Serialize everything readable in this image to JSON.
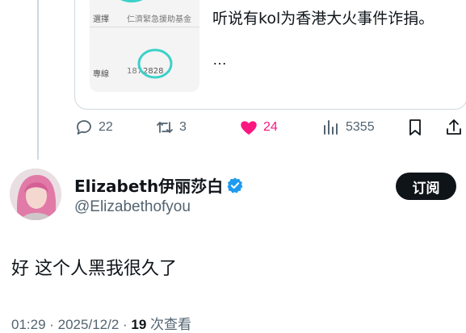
{
  "quoted": {
    "image_rows": [
      {
        "label": "選擇",
        "value": "仁濟緊急援助基金"
      },
      {
        "label": "專線",
        "value_prefix": "187",
        "value_suffix": "2828"
      }
    ],
    "text": "听说有kol为香港大火事件诈捐。",
    "ellipsis": "…"
  },
  "actions": {
    "replies": "22",
    "reposts": "3",
    "likes": "24",
    "views": "5355"
  },
  "colors": {
    "like": "#f91880",
    "muted": "#536471",
    "verified": "#1d9bf0"
  },
  "author": {
    "display_name": "Elizabeth伊丽莎白",
    "handle": "@Elizabethofyou",
    "subscribe_label": "订阅"
  },
  "tweet": {
    "text": "好 这个人黑我很久了"
  },
  "meta": {
    "time_date": "01:29 · 2025/12/2 · ",
    "views_count": "19",
    "views_label": " 次查看"
  }
}
